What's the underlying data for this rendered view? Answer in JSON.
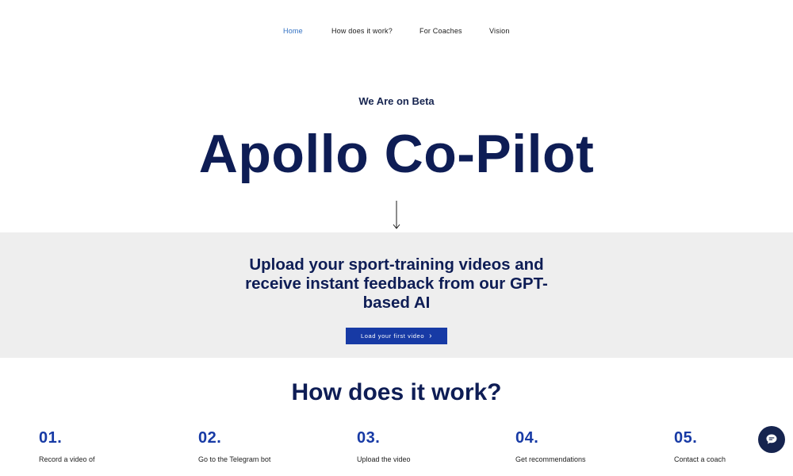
{
  "nav": {
    "items": [
      {
        "label": "Home",
        "active": true
      },
      {
        "label": "How does it work?",
        "active": false
      },
      {
        "label": "For Coaches",
        "active": false
      },
      {
        "label": "Vision",
        "active": false
      }
    ]
  },
  "hero": {
    "beta_label": "We Are on Beta",
    "title": "Apollo Co-Pilot",
    "arrow_icon": "arrow-down-icon"
  },
  "band": {
    "text": "Upload your sport-training videos and receive instant feedback from our GPT-based AI",
    "cta_label": "Load your first video",
    "cta_icon": "chevron-right-icon",
    "background": "#eeeeee",
    "cta_color": "#173aa5"
  },
  "how": {
    "title": "How does it work?",
    "steps": [
      {
        "number": "01.",
        "text": "Record a video of"
      },
      {
        "number": "02.",
        "text": "Go to the Telegram bot"
      },
      {
        "number": "03.",
        "text": "Upload the video"
      },
      {
        "number": "04.",
        "text": "Get recommendations"
      },
      {
        "number": "05.",
        "text": "Contact a coach"
      }
    ]
  },
  "chat": {
    "icon": "chat-bubble-icon",
    "color": "#16244f"
  },
  "colors": {
    "accent": "#173aa5",
    "heading": "#0e1d55",
    "nav_active": "#2f6fc2"
  }
}
